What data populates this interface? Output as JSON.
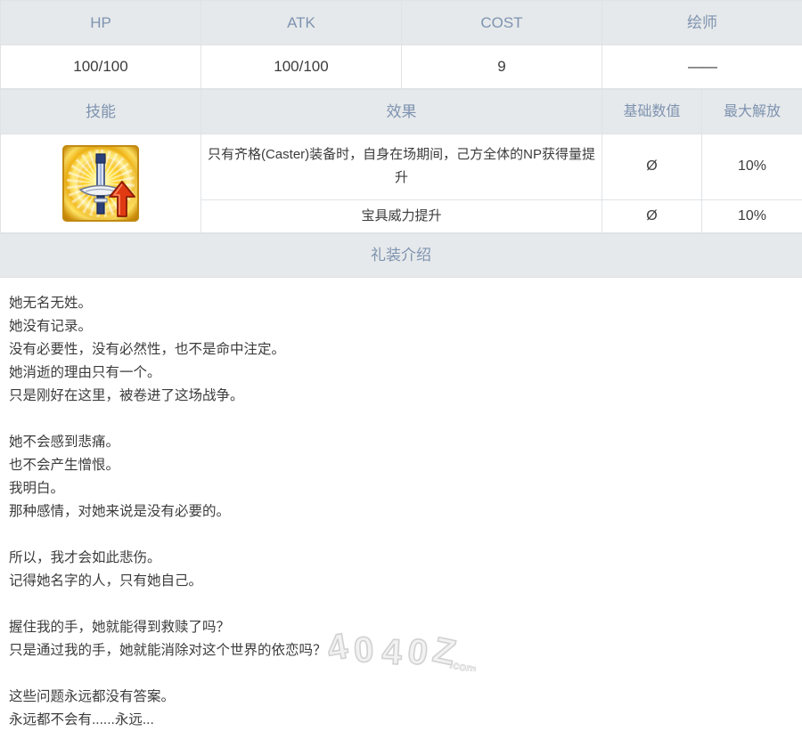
{
  "stats": {
    "headers": [
      "HP",
      "ATK",
      "COST",
      "绘师"
    ],
    "values": [
      "100/100",
      "100/100",
      "9",
      "——"
    ]
  },
  "skills": {
    "headers": [
      "技能",
      "效果",
      "基础数值",
      "最大解放"
    ],
    "icon_name": "np-gain-up-sword-icon",
    "rows": [
      {
        "effect": "只有齐格(Caster)装备时，自身在场期间，己方全体的NP获得量提升",
        "base": "Ø",
        "max": "10%"
      },
      {
        "effect": "宝具威力提升",
        "base": "Ø",
        "max": "10%"
      }
    ]
  },
  "intro": {
    "title": "礼装介绍",
    "lines": [
      "她无名无姓。",
      "她没有记录。",
      "没有必要性，没有必然性，也不是命中注定。",
      "她消逝的理由只有一个。",
      "只是刚好在这里，被卷进了这场战争。",
      "",
      "她不会感到悲痛。",
      "也不会产生憎恨。",
      "我明白。",
      "那种感情，对她来说是没有必要的。",
      "",
      "所以，我才会如此悲伤。",
      "记得她名字的人，只有她自己。",
      "",
      "握住我的手，她就能得到救赎了吗？",
      "只是通过我的手，她就能消除对这个世界的依恋吗？",
      "",
      "这些问题永远都没有答案。",
      "永远都不会有......永远..."
    ]
  },
  "watermark": {
    "text": "4040Z",
    "suffix": ".com"
  },
  "colors": {
    "header_bg": "#e6e9eb",
    "header_text": "#7e93b0",
    "body_text": "#3c3c3c",
    "border": "#dfe3e6",
    "icon_gold": "#f6c321",
    "icon_arrow_red": "#e03a12",
    "icon_blade_blue": "#2b3f7a"
  }
}
